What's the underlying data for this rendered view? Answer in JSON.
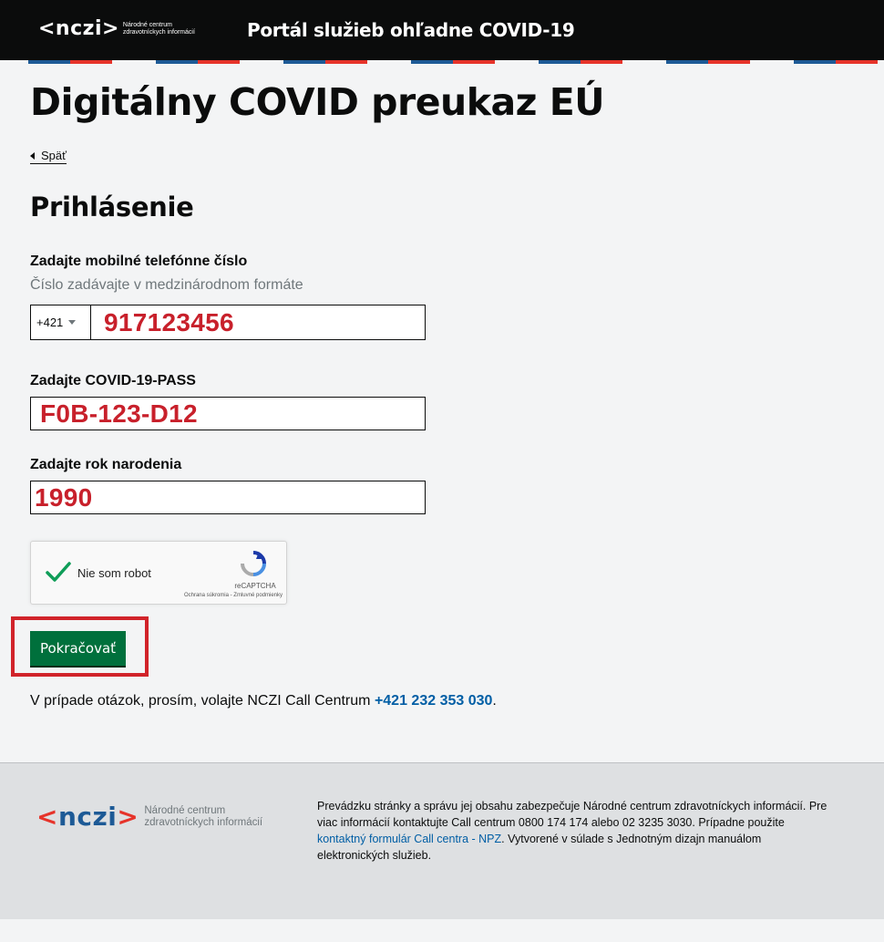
{
  "header": {
    "logo_brand": "<nczi>",
    "logo_subtitle": "Národné centrum zdravotníckych informácií",
    "portal_title": "Portál služieb ohľadne COVID-19",
    "stripe_colors": [
      "#1d5a96",
      "#e6332a"
    ]
  },
  "page": {
    "title": "Digitálny COVID preukaz EÚ",
    "back_label": "Späť",
    "section_title": "Prihlásenie"
  },
  "form": {
    "phone_label": "Zadajte mobilné telefónne číslo",
    "phone_hint": "Číslo zadávajte v medzinárodnom formáte",
    "phone_prefix": "+421",
    "phone_value": "917123456",
    "pass_label": "Zadajte COVID-19-PASS",
    "pass_value": "F0B-123-D12",
    "birth_label": "Zadajte rok narodenia",
    "birth_value": "1990",
    "submit_label": "Pokračovať"
  },
  "captcha": {
    "label": "Nie som robot",
    "brand": "reCAPTCHA",
    "terms": "Ochrana súkromia - Zmluvné podmienky",
    "checked": true
  },
  "contact": {
    "text": "V prípade otázok, prosím, volajte NCZI Call Centrum",
    "phone": "+421 232 353 030",
    "suffix": "."
  },
  "footer": {
    "logo_brand": "<nczi>",
    "logo_subtitle": "Národné centrum zdravotníckych informácií",
    "text_before_link": "Prevádzku stránky a správu jej obsahu zabezpečuje Národné centrum zdravotníckych informácií. Pre viac informácií kontaktujte Call centrum 0800 174 174 alebo 02 3235 3030. Prípadne použite",
    "link_label": "kontaktný formulár Call centra - NPZ",
    "text_after_link": ". Vytvorené v súlade s Jednotným dizajn manuálom elektronických služieb."
  },
  "colors": {
    "header_bg": "#0b0c0c",
    "button_green": "#00703c",
    "highlight_red": "#d1232a",
    "annotation_red": "#c8202b",
    "link_blue": "#005ea5"
  }
}
